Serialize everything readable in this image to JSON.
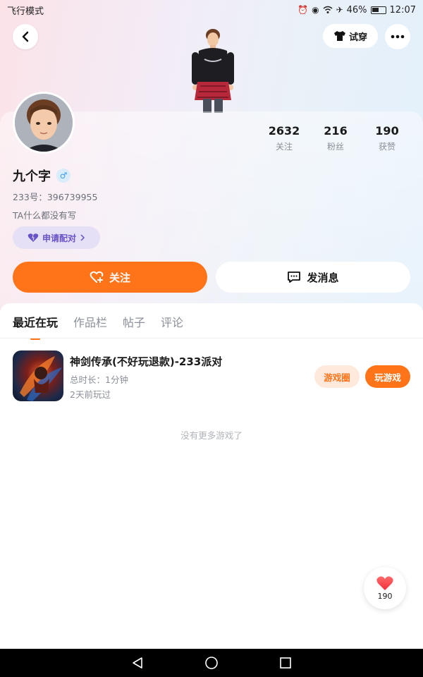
{
  "status_bar": {
    "left_text": "飞行模式",
    "battery_percent": "46%",
    "time": "12:07"
  },
  "header": {
    "try_on_label": "试穿",
    "back_icon": "chevron-left-icon",
    "more_icon": "more-dots-icon"
  },
  "profile": {
    "name": "九个字",
    "gender_symbol": "♂",
    "id_line": "233号：396739955",
    "bio": "TA什么都没有写",
    "pair_label": "申请配对",
    "stats": [
      {
        "value": "2632",
        "label": "关注"
      },
      {
        "value": "216",
        "label": "粉丝"
      },
      {
        "value": "190",
        "label": "获赞"
      }
    ]
  },
  "actions": {
    "follow_label": "关注",
    "message_label": "发消息"
  },
  "tabs": [
    {
      "label": "最近在玩",
      "active": true
    },
    {
      "label": "作品栏",
      "active": false
    },
    {
      "label": "帖子",
      "active": false
    },
    {
      "label": "评论",
      "active": false
    }
  ],
  "games": [
    {
      "title": "神剑传承(不好玩退款)-233派对",
      "duration": "总时长：1分钟",
      "last_played": "2天前玩过",
      "circle_label": "游戏圈",
      "play_label": "玩游戏"
    }
  ],
  "empty_hint": "没有更多游戏了",
  "like_fab": {
    "count": "190"
  },
  "colors": {
    "accent": "#ff7418",
    "accent_light": "#ffe9dd",
    "pair_bg": "#e6e0f7",
    "pair_text": "#6a52c7"
  }
}
